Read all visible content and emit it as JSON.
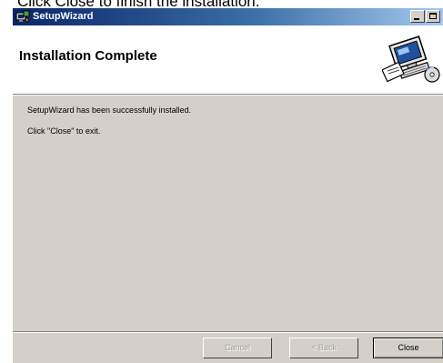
{
  "caption": {
    "text": "Click Close to finish the installation."
  },
  "window": {
    "title": "SetupWizard"
  },
  "header": {
    "title": "Installation Complete"
  },
  "body": {
    "message_line1": "SetupWizard has been successfully installed.",
    "message_line2": "Click \"Close\" to exit."
  },
  "buttons": {
    "cancel_label": "Cancel",
    "back_label": "< Back",
    "close_label": "Close"
  },
  "colors": {
    "titlebar_start": "#0a246a",
    "titlebar_end": "#a6caf0",
    "dialog_face": "#d4d0c8",
    "disabled_text": "#a0a0a0"
  },
  "icons": {
    "titlebar": "installer-icon",
    "header": "computer-install-icon"
  }
}
